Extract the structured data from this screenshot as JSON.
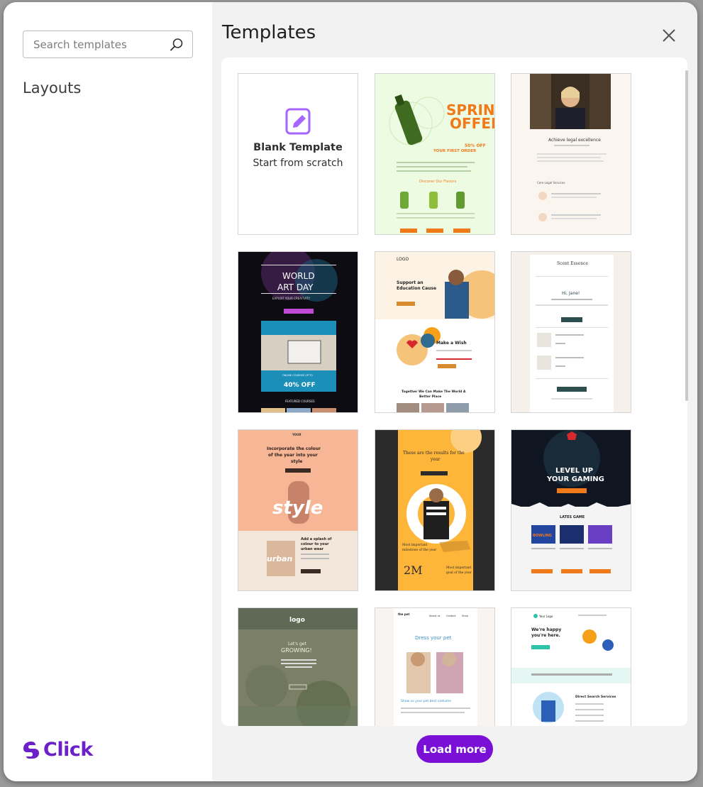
{
  "sidebar": {
    "search_placeholder": "Search templates",
    "section_label": "Layouts",
    "brand": "Click"
  },
  "header": {
    "title": "Templates"
  },
  "blank_card": {
    "title": "Blank Template",
    "subtitle": "Start from scratch"
  },
  "templates": [
    {
      "name": "spring-offer",
      "texts": [
        "SPRING",
        "OFFER",
        "50% OFF",
        "YOUR FIRST ORDER",
        "Discover Our Flavors"
      ]
    },
    {
      "name": "legal-excellence",
      "texts": [
        "Achieve legal excellence",
        "Core Legal Services"
      ]
    },
    {
      "name": "world-art-day",
      "texts": [
        "WORLD",
        "ART DAY",
        "EXPLOIT YOUR CREATIVITY",
        "ONLINE COURSES UP TO",
        "40% OFF",
        "FEATURED COURSES"
      ]
    },
    {
      "name": "education-cause",
      "texts": [
        "Support an",
        "Education Cause",
        "Make a Wish",
        "Together We Can Make The World A",
        "Better Place"
      ]
    },
    {
      "name": "scent-essence",
      "texts": [
        "Scent Essence",
        "Hi, Jane!"
      ]
    },
    {
      "name": "style-fashion",
      "texts": [
        "Incorporate the colour",
        "of the year into your",
        "style",
        "Add a splash of",
        "colour to your",
        "urban wear",
        "urban"
      ]
    },
    {
      "name": "results-year",
      "texts": [
        "These are the results for the",
        "year",
        "Most important",
        "milestone of the year",
        "2M",
        "goal of the year"
      ]
    },
    {
      "name": "gaming",
      "texts": [
        "LEVEL UP",
        "YOUR GAMING",
        "LATES GAME",
        "BOWLING"
      ]
    },
    {
      "name": "growing",
      "texts": [
        "logo",
        "Let's get",
        "GROWING!"
      ]
    },
    {
      "name": "pet-model",
      "texts": [
        "Dress your pet",
        "Show us your pet best costume",
        "About us",
        "Contact",
        "Shop"
      ]
    },
    {
      "name": "your-logo",
      "texts": [
        "Your Logo",
        "We're happy",
        "you're here.",
        "Direct Search Services"
      ]
    }
  ],
  "footer": {
    "load_more": "Load more"
  },
  "colors": {
    "accent": "#7a0fd6",
    "brand": "#6b20c9",
    "blank_icon": "#a765ff"
  }
}
